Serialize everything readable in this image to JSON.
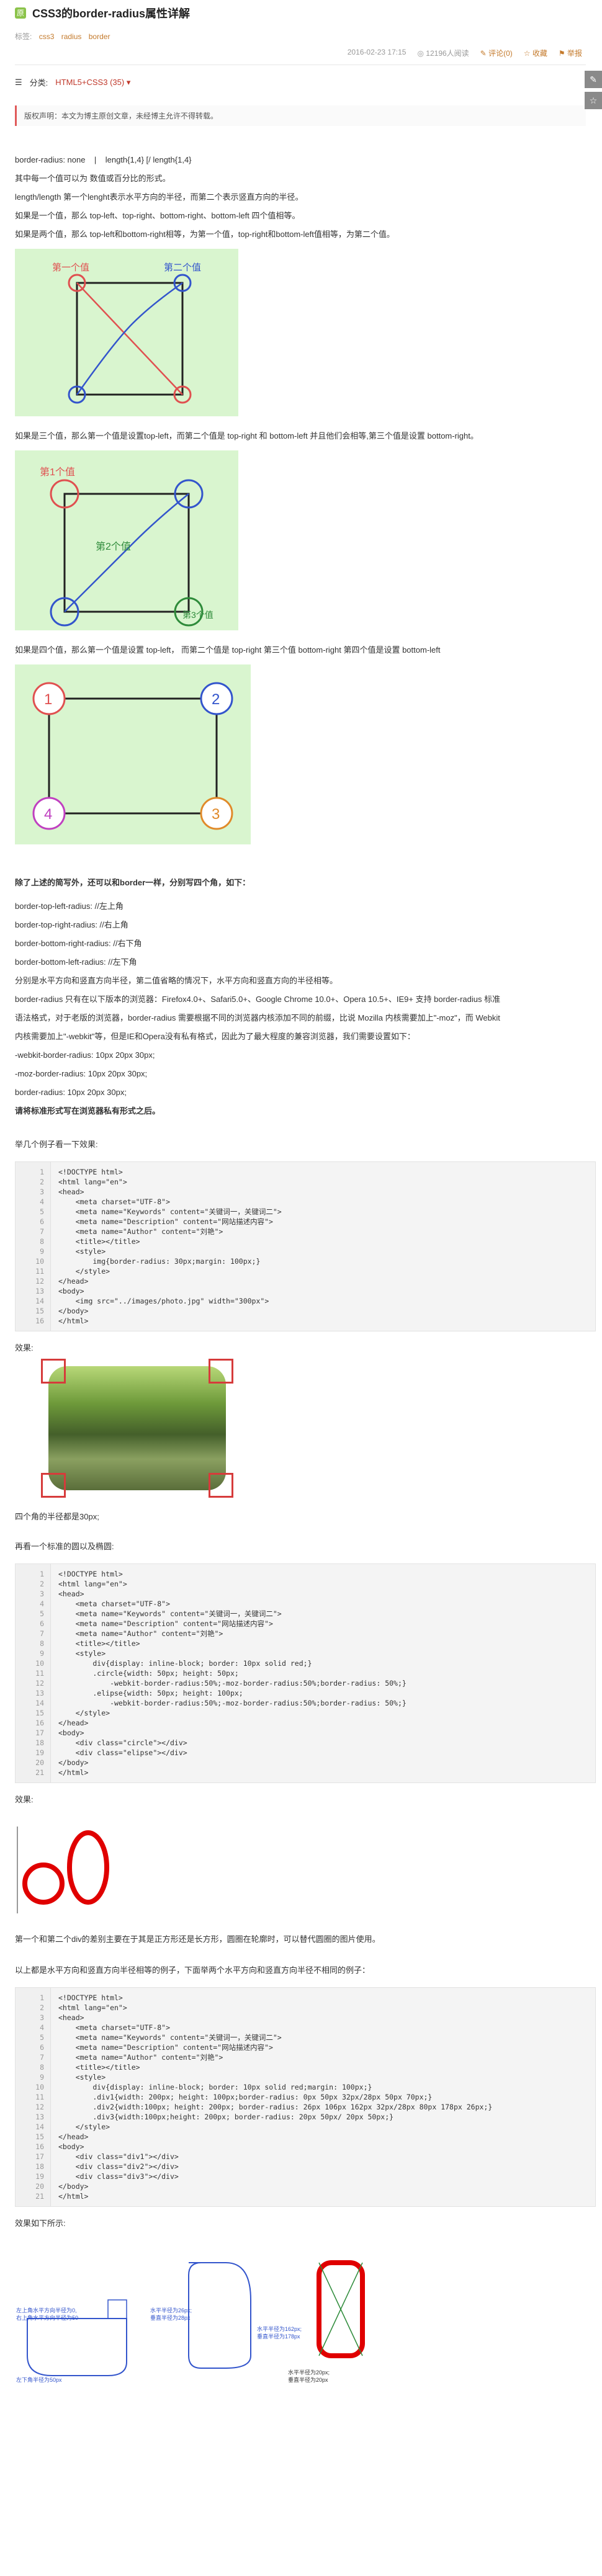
{
  "header": {
    "title": "CSS3的border-radius属性详解",
    "tags_label": "标签:",
    "tags": [
      "css3",
      "radius",
      "border"
    ],
    "date": "2016-02-23 17:15",
    "views": "12196人阅读",
    "comments": "评论(0)",
    "favorite": "收藏",
    "report": "举报"
  },
  "category": {
    "label": "分类:",
    "name": "HTML5+CSS3",
    "count": "(35)"
  },
  "notice": "版权声明：本文为博主原创文章，未经博主允许不得转载。",
  "para": {
    "p1": "border-radius: none    |    length{1,4} [/ length{1,4}",
    "p2": "其中每一个值可以为 数值或百分比的形式。",
    "p3": "length/length    第一个lenght表示水平方向的半径，而第二个表示竖直方向的半径。",
    "p4": "如果是一个值，那么 top-left、top-right、bottom-right、bottom-left 四个值相等。",
    "p5": "如果是两个值，那么 top-left和bottom-right相等，为第一个值，top-right和bottom-left值相等，为第二个值。",
    "p6": "如果是三个值，那么第一个值是设置top-left，而第二个值是 top-right 和 bottom-left 并且他们会相等,第三个值是设置 bottom-right。",
    "p7": "如果是四个值，那么第一个值是设置 top-left， 而第二个值是 top-right 第三个值 bottom-right 第四个值是设置 bottom-left",
    "p8": "除了上述的简写外，还可以和border一样，分别写四个角，如下：",
    "p9": "border-top-left-radius: //左上角",
    "p10": "border-top-right-radius: //右上角",
    "p11": "border-bottom-right-radius: //右下角",
    "p12": "border-bottom-left-radius: //左下角",
    "p13": "分别是水平方向和竖直方向半径，第二值省略的情况下，水平方向和竖直方向的半径相等。",
    "p14a": "border-radius 只有在以下版本的浏览器：Firefox4.0+、Safari5.0+、Google Chrome 10.0+、Opera 10.5+、IE9+ 支持 border-radius 标准",
    "p14b": "语法格式，对于老版的浏览器，border-radius 需要根据不同的浏览器内核添加不同的前缀，比说 Mozilla 内核需要加上\"-moz\"，而 Webkit",
    "p14c": "内核需要加上\"-webkit\"等，但是IE和Opera没有私有格式，因此为了最大程度的兼容浏览器，我们需要设置如下：",
    "p15": "-webkit-border-radius: 10px 20px 30px;",
    "p16": "-moz-border-radius: 10px 20px 30px;",
    "p17": "border-radius: 10px 20px 30px;",
    "p18": "请将标准形式写在浏览器私有形式之后。",
    "p19": "举几个例子看一下效果:",
    "p20": "效果:",
    "p21": "四个角的半径都是30px;",
    "p22": "再看一个标准的圆以及椭圆:",
    "p23": "效果:",
    "p24": "第一个和第二个div的差别主要在于其是正方形还是长方形，圆圈在轮廓时，可以替代圆圈的图片使用。",
    "p25": "以上都是水平方向和竖直方向半径相等的例子，下面举两个水平方向和竖直方向半径不相同的例子：",
    "p26": "效果如下所示:"
  },
  "fig1": {
    "label1": "第一个值",
    "label2": "第二个值"
  },
  "fig2": {
    "label1": "第1个值",
    "label2": "第2个值",
    "label3": "第3个值"
  },
  "fig3": {
    "n1": "1",
    "n2": "2",
    "n3": "3",
    "n4": "4"
  },
  "code1": {
    "line_numbers": "1\n2\n3\n4\n5\n6\n7\n8\n9\n10\n11\n12\n13\n14\n15\n16",
    "text": "<!DOCTYPE html>\n<html lang=\"en\">\n<head>\n    <meta charset=\"UTF-8\">\n    <meta name=\"Keywords\" content=\"关键词一，关键词二\">\n    <meta name=\"Description\" content=\"网站描述内容\">\n    <meta name=\"Author\" content=\"刘艳\">\n    <title></title>\n    <style>\n        img{border-radius: 30px;margin: 100px;}\n    </style>\n</head>\n<body>\n    <img src=\"../images/photo.jpg\" width=\"300px\">\n</body>\n</html>"
  },
  "code2": {
    "line_numbers": "1\n2\n3\n4\n5\n6\n7\n8\n9\n10\n11\n12\n13\n14\n15\n16\n17\n18\n19\n20\n21",
    "text": "<!DOCTYPE html>\n<html lang=\"en\">\n<head>\n    <meta charset=\"UTF-8\">\n    <meta name=\"Keywords\" content=\"关键词一，关键词二\">\n    <meta name=\"Description\" content=\"网站描述内容\">\n    <meta name=\"Author\" content=\"刘艳\">\n    <title></title>\n    <style>\n        div{display: inline-block; border: 10px solid red;}\n        .circle{width: 50px; height: 50px;\n            -webkit-border-radius:50%;-moz-border-radius:50%;border-radius: 50%;}\n        .elipse{width: 50px; height: 100px;\n            -webkit-border-radius:50%;-moz-border-radius:50%;border-radius: 50%;}\n    </style>\n</head>\n<body>\n    <div class=\"circle\"></div>\n    <div class=\"elipse\"></div>\n</body>\n</html>"
  },
  "code3": {
    "line_numbers": "1\n2\n3\n4\n5\n6\n7\n8\n9\n10\n11\n12\n13\n14\n15\n16\n17\n18\n19\n20\n21",
    "text": "<!DOCTYPE html>\n<html lang=\"en\">\n<head>\n    <meta charset=\"UTF-8\">\n    <meta name=\"Keywords\" content=\"关键词一，关键词二\">\n    <meta name=\"Description\" content=\"网站描述内容\">\n    <meta name=\"Author\" content=\"刘艳\">\n    <title></title>\n    <style>\n        div{display: inline-block; border: 10px solid red;margin: 100px;}\n        .div1{width: 200px; height: 100px;border-radius: 0px 50px 32px/28px 50px 70px;}\n        .div2{width:100px; height: 200px; border-radius: 26px 106px 162px 32px/28px 80px 178px 26px;}\n        .div3{width:100px;height: 200px; border-radius: 20px 50px/ 20px 50px;}\n    </style>\n</head>\n<body>\n    <div class=\"div1\"></div>\n    <div class=\"div2\"></div>\n    <div class=\"div3\"></div>\n</body>\n</html>"
  },
  "fig_last": {
    "a1": "左上角水平方向半径为0,",
    "a2": "右上角水平方向半径为50",
    "a3": "左下角半径为50px",
    "a4": "水平半径为26px;",
    "a5": "垂直半径为28px",
    "a6": "水平半径为162px;",
    "a7": "垂直半径为178px",
    "a8": "水平半径为20px;",
    "a9": "垂直半径为20px"
  }
}
